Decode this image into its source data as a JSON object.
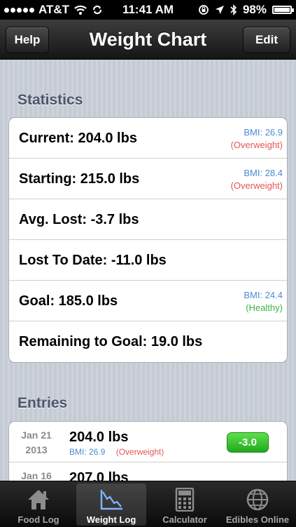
{
  "status_bar": {
    "carrier": "AT&T",
    "time": "11:41 AM",
    "battery": "98%",
    "battery_level": 0.98
  },
  "nav": {
    "title": "Weight Chart",
    "help_label": "Help",
    "edit_label": "Edit"
  },
  "statistics": {
    "header": "Statistics",
    "rows": [
      {
        "label": "Current: 204.0 lbs",
        "bmi": "BMI: 26.9",
        "category": "(Overweight)"
      },
      {
        "label": "Starting: 215.0 lbs",
        "bmi": "BMI: 28.4",
        "category": "(Overweight)"
      },
      {
        "label": "Avg. Lost: -3.7 lbs"
      },
      {
        "label": "Lost To Date: -11.0 lbs"
      },
      {
        "label": "Goal: 185.0 lbs",
        "bmi": "BMI: 24.4",
        "category": "(Healthy)"
      },
      {
        "label": "Remaining to Goal: 19.0 lbs"
      }
    ]
  },
  "entries": {
    "header": "Entries",
    "rows": [
      {
        "month_day": "Jan 21",
        "year": "2013",
        "weight": "204.0 lbs",
        "bmi": "BMI: 26.9",
        "category": "(Overweight)",
        "change": "-3.0"
      },
      {
        "month_day": "Jan 16",
        "year": "",
        "weight": "207.0 lbs",
        "bmi": "",
        "category": "",
        "change": ""
      }
    ]
  },
  "tabs": [
    {
      "label": "Food Log",
      "icon": "house-icon"
    },
    {
      "label": "Weight Log",
      "icon": "chart-icon",
      "active": true
    },
    {
      "label": "Calculator",
      "icon": "calculator-icon"
    },
    {
      "label": "Edibles Online",
      "icon": "globe-icon"
    }
  ],
  "colors": {
    "bmi": "#4b8ad8",
    "overweight": "#e35555",
    "healthy": "#3db446",
    "badge_green": "#2bb023"
  }
}
